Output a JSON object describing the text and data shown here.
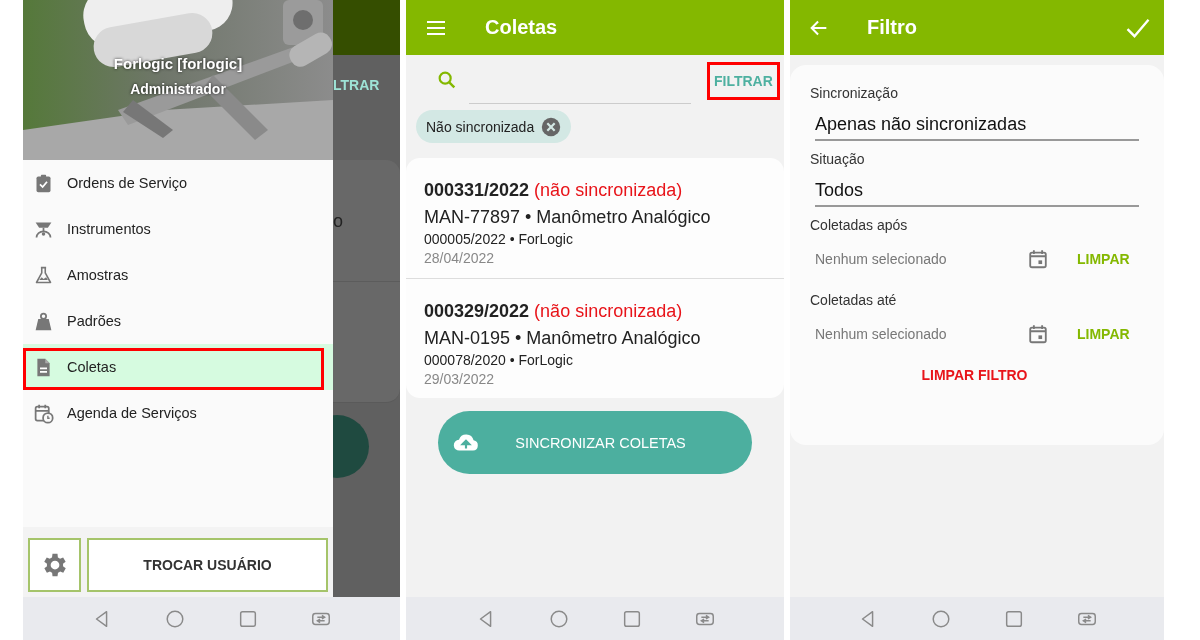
{
  "drawer_screen": {
    "dimmed_app": {
      "filter_fragment": "LTRAR",
      "text_fragment": "o"
    },
    "header": {
      "user_name": "Forlogic [forlogic]",
      "role": "Administrador"
    },
    "menu": [
      {
        "label": "Ordens de Serviço",
        "selected": false,
        "highlighted": false
      },
      {
        "label": "Instrumentos",
        "selected": false,
        "highlighted": false
      },
      {
        "label": "Amostras",
        "selected": false,
        "highlighted": false
      },
      {
        "label": "Padrões",
        "selected": false,
        "highlighted": false
      },
      {
        "label": "Coletas",
        "selected": true,
        "highlighted": true
      },
      {
        "label": "Agenda de Serviços",
        "selected": false,
        "highlighted": false
      }
    ],
    "switch_user_button": "TROCAR USUÁRIO"
  },
  "list_screen": {
    "title": "Coletas",
    "filter_button": {
      "label": "FILTRAR",
      "highlighted": true
    },
    "chips": [
      {
        "label": "Não sincronizada"
      }
    ],
    "items": [
      {
        "number": "000331/2022",
        "status": "(não sincronizada)",
        "instrument": "MAN-77897 • Manômetro Analógico",
        "detail": "000005/2022 • ForLogic",
        "date": "28/04/2022"
      },
      {
        "number": "000329/2022",
        "status": "(não sincronizada)",
        "instrument": "MAN-0195 • Manômetro Analógico",
        "detail": "000078/2020 • ForLogic",
        "date": "29/03/2022"
      }
    ],
    "sync_button": "SINCRONIZAR COLETAS"
  },
  "filter_screen": {
    "title": "Filtro",
    "fields": [
      {
        "kind": "select",
        "label": "Sincronização",
        "value": "Apenas não sincronizadas"
      },
      {
        "kind": "select",
        "label": "Situação",
        "value": "Todos"
      },
      {
        "kind": "date",
        "label": "Coletadas após",
        "placeholder": "Nenhum selecionado",
        "clear": "LIMPAR"
      },
      {
        "kind": "date",
        "label": "Coletadas até",
        "placeholder": "Nenhum selecionado",
        "clear": "LIMPAR"
      }
    ],
    "clear_filter": "LIMPAR FILTRO"
  }
}
